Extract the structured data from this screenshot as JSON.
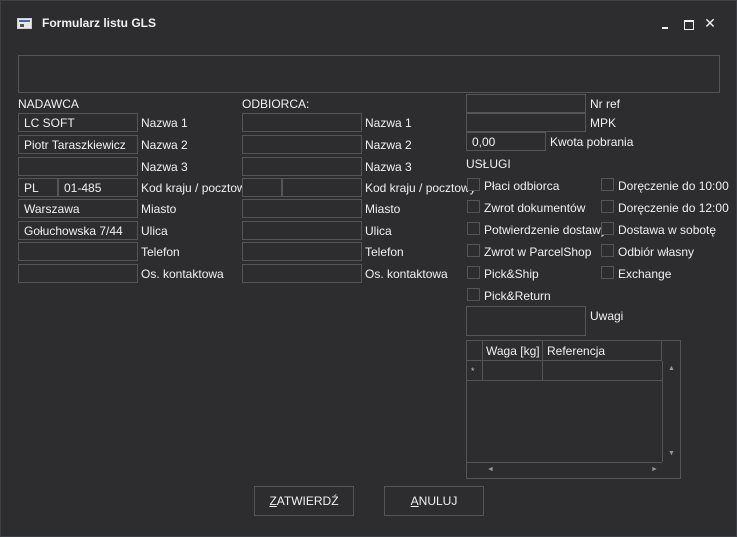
{
  "window": {
    "title": "Formularz listu GLS",
    "controls": {
      "minimize": "minimize-icon",
      "maximize": "maximize-icon",
      "close": "close-icon",
      "close_glyph": "✕"
    }
  },
  "top_field": {
    "value": ""
  },
  "sender": {
    "heading": "NADAWCA",
    "name1": "LC SOFT",
    "name2": "Piotr Taraszkiewicz",
    "name3": "",
    "country": "PL",
    "postal": "01-485",
    "city": "Warszawa",
    "street": "Gołuchowska 7/44",
    "phone": "",
    "contact": ""
  },
  "recipient": {
    "heading": "ODBIORCA:",
    "name1": "",
    "name2": "",
    "name3": "",
    "country": "",
    "postal": "",
    "city": "",
    "street": "",
    "phone": "",
    "contact": ""
  },
  "labels": {
    "name1": "Nazwa 1",
    "name2": "Nazwa 2",
    "name3": "Nazwa 3",
    "country_postal": "Kod kraju / pocztowy",
    "city": "Miasto",
    "street": "Ulica",
    "phone": "Telefon",
    "contact": "Os. kontaktowa"
  },
  "right": {
    "nr_ref_label": "Nr ref",
    "nr_ref_value": "",
    "mpk_label": "MPK",
    "mpk_value": "",
    "cod_label": "Kwota pobrania",
    "cod_value": "0,00",
    "services_heading": "USŁUGI",
    "notes_label": "Uwagi",
    "notes_value": ""
  },
  "services": {
    "left": [
      {
        "label": "Płaci odbiorca",
        "checked": false
      },
      {
        "label": "Zwrot dokumentów",
        "checked": false
      },
      {
        "label": "Potwierdzenie dostawy",
        "checked": false
      },
      {
        "label": "Zwrot w ParcelShop",
        "checked": false
      },
      {
        "label": "Pick&Ship",
        "checked": false
      },
      {
        "label": "Pick&Return",
        "checked": false
      }
    ],
    "right": [
      {
        "label": "Doręczenie do 10:00",
        "checked": false
      },
      {
        "label": "Doręczenie do 12:00",
        "checked": false
      },
      {
        "label": "Dostawa w sobotę",
        "checked": false
      },
      {
        "label": "Odbiór własny",
        "checked": false
      },
      {
        "label": "Exchange",
        "checked": false
      }
    ]
  },
  "parcel_grid": {
    "columns": [
      "Waga [kg]",
      "Referencja"
    ],
    "new_row_marker": "*",
    "arrows": {
      "up": "▲",
      "down": "▼",
      "left": "◄",
      "right": "►"
    }
  },
  "buttons": {
    "confirm_first": "Z",
    "confirm_rest": "ATWIERDŹ",
    "cancel_first": "A",
    "cancel_rest": "NULUJ"
  }
}
